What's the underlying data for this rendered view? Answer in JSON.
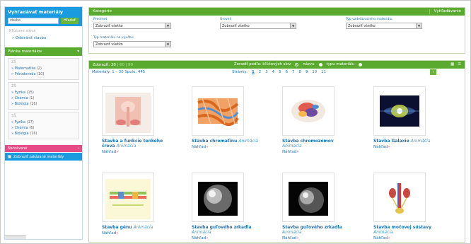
{
  "sidebar": {
    "title": "Vyhľadávať materiály",
    "search_value": "stavba",
    "search_button": "Hľadať",
    "keywords_title": "Kľúčové slová",
    "keyword_item": "Odstrániť stavba",
    "plan_title": "Plánka materiálov",
    "groups": [
      {
        "title": "ZŠ",
        "items": [
          {
            "label": "Matematika",
            "count": "(2)"
          },
          {
            "label": "Prírodoveda",
            "count": "(10)"
          }
        ]
      },
      {
        "title": "ZŠ",
        "items": [
          {
            "label": "Fyzika",
            "count": "(15)"
          },
          {
            "label": "Chémia",
            "count": "(1)"
          },
          {
            "label": "Biológia",
            "count": "(16)"
          }
        ]
      },
      {
        "title": "SŠ",
        "items": [
          {
            "label": "Fyzika",
            "count": "(17)"
          },
          {
            "label": "Chémia",
            "count": "(6)"
          },
          {
            "label": "Biológia",
            "count": "(16)"
          }
        ]
      }
    ],
    "pink_bar_label": "Nahrávané",
    "show_zero_label": "Zobraziť zakázané materiály"
  },
  "category": {
    "title": "Kategórie",
    "action": "Vyhľadávanie",
    "filters": [
      {
        "label": "Predmet",
        "value": "Zobraziť všetko"
      },
      {
        "label": "Úroveň",
        "value": "Zobraziť všetko"
      },
      {
        "label": "Typ vzdelávacieho materiálu",
        "value": "Zobraziť všetko"
      },
      {
        "label": "Typ materiálu na výučbu",
        "value": "Zobraziť všetko"
      }
    ]
  },
  "results": {
    "show_label": "Zobraziť:",
    "show_options": [
      "30",
      "60",
      "90"
    ],
    "sort_label": "Zoradiť podľa: kľúčových slov",
    "sort_name": "názvu",
    "sort_type": "typu materiálu",
    "count_text": "Materiály: 1 – 30 Spolu: 445",
    "pages_label": "Stránky:",
    "pages": [
      "1",
      "2",
      "3",
      "4",
      "5",
      "6",
      "7",
      "8",
      "9",
      "10",
      "11"
    ],
    "next_label": "›",
    "grid_icon": "▦",
    "list_icon": "☰",
    "items": [
      {
        "title": "Stavba a funkcie tenkého čreva",
        "type": "Animácia",
        "preview": "Náhľad"
      },
      {
        "title": "Stavba chromatínu",
        "type": "Animácia",
        "preview": "Náhľad"
      },
      {
        "title": "Stavba chromozómov",
        "type": "Animácia",
        "preview": "Náhľad"
      },
      {
        "title": "Stavba Galaxie",
        "type": "Animácia",
        "preview": "Náhľad"
      },
      {
        "title": "Stavba génu",
        "type": "Animácia",
        "preview": "Náhľad"
      },
      {
        "title": "Stavba guľového zrkadla",
        "type": "Animácia",
        "preview": "Náhľad"
      },
      {
        "title": "Stavba guľového zrkadla",
        "type": "Animácia",
        "preview": "Náhľad"
      },
      {
        "title": "Stavba močovej sústavy",
        "type": "Animácia",
        "preview": "Náhľad"
      }
    ]
  },
  "colors": {
    "blue": "#1a9be0",
    "green": "#5aaa2f",
    "pink": "#e64c86",
    "link": "#1b74b9"
  }
}
